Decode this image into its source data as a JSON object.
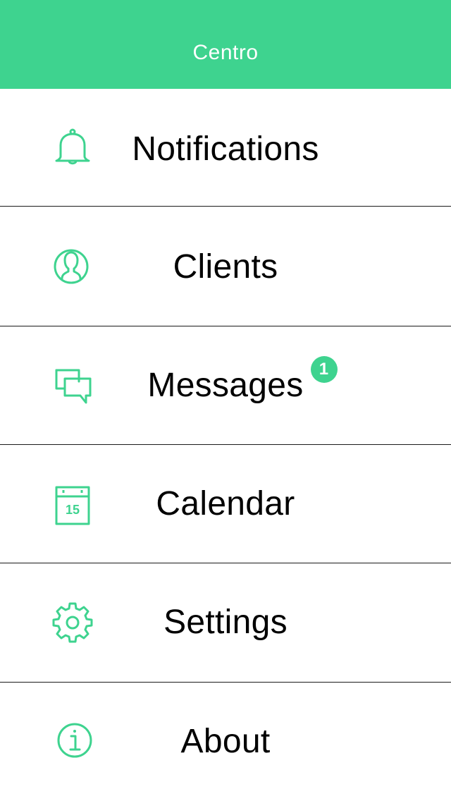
{
  "header": {
    "title": "Centro"
  },
  "theme": {
    "accent": "#3ed38f",
    "divider": "#1a1a1a",
    "text": "#000000"
  },
  "menu": {
    "items": [
      {
        "label": "Notifications",
        "icon": "bell-icon"
      },
      {
        "label": "Clients",
        "icon": "user-circle-icon"
      },
      {
        "label": "Messages",
        "icon": "chat-bubbles-icon",
        "badge": "1"
      },
      {
        "label": "Calendar",
        "icon": "calendar-icon",
        "icon_text": "15"
      },
      {
        "label": "Settings",
        "icon": "gear-icon"
      },
      {
        "label": "About",
        "icon": "info-icon"
      }
    ]
  }
}
